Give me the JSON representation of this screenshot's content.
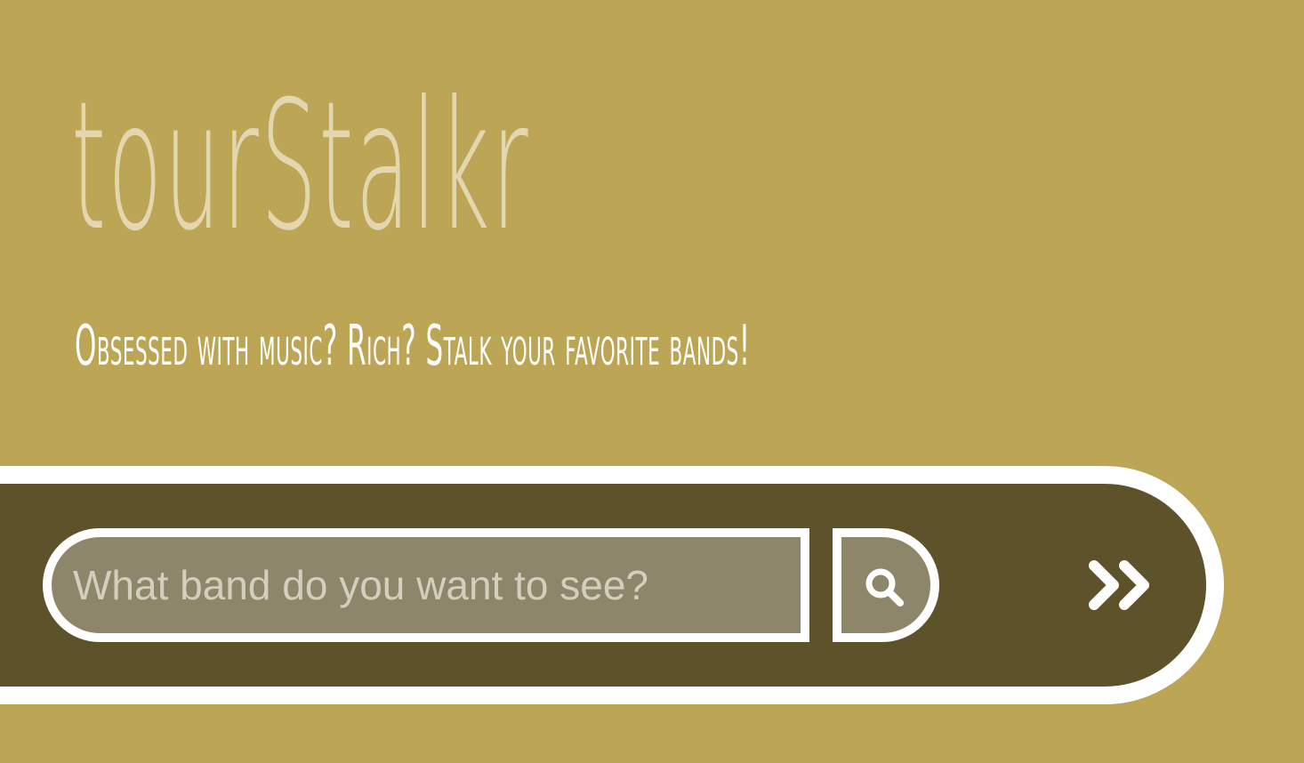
{
  "header": {
    "title": "tourStalkr",
    "tagline": "Obsessed with music? Rich? Stalk your favorite bands!"
  },
  "search": {
    "placeholder": "What band do you want to see?",
    "value": "",
    "search_icon": "magnifier-icon",
    "next_icon": "double-chevron-right-icon"
  },
  "colors": {
    "background": "#bca555",
    "band": "#5e522b",
    "field": "#8e866b",
    "title": "#e3d7af",
    "outline": "#ffffff"
  }
}
